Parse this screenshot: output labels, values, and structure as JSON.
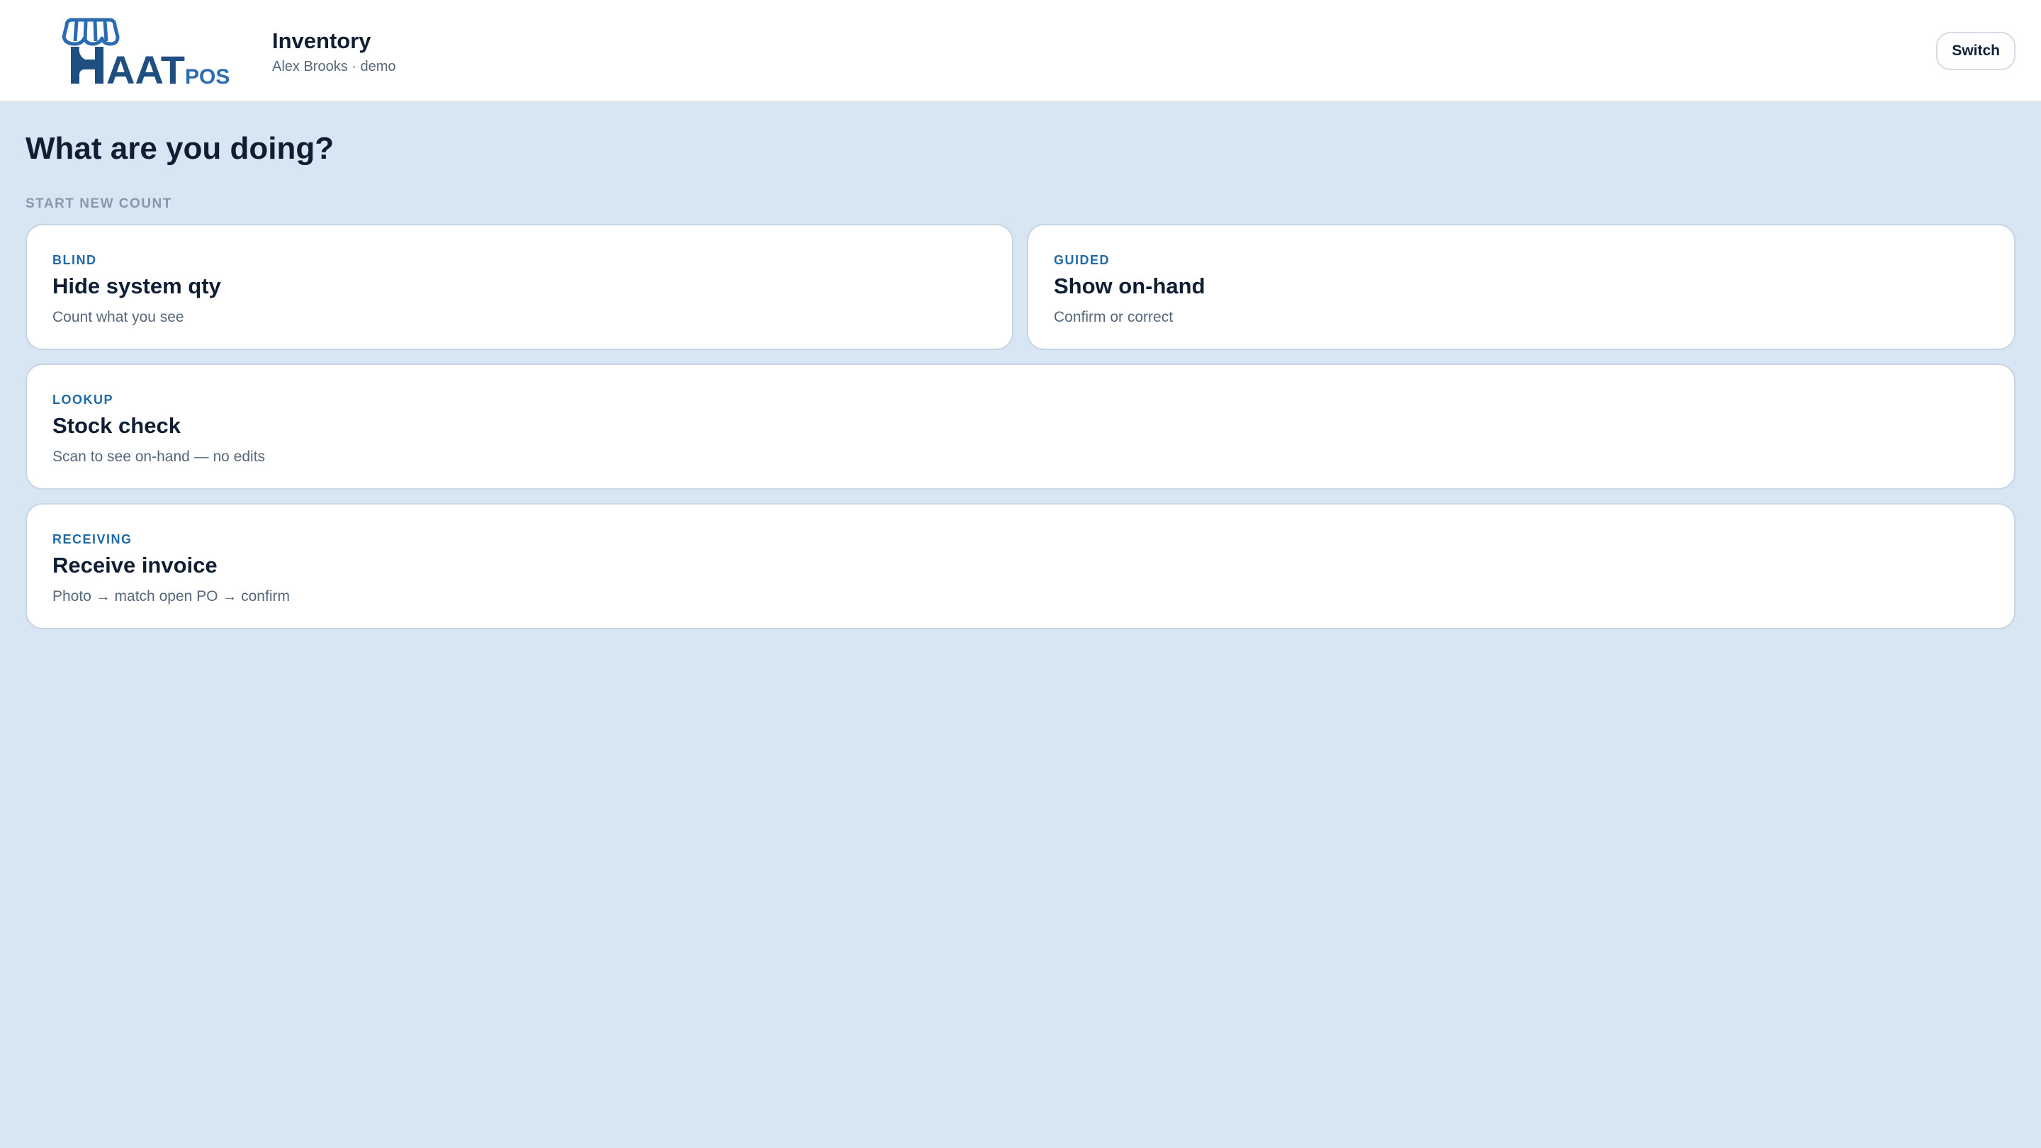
{
  "header": {
    "logo": {
      "wordmark": "HAAT",
      "suffix": "POS",
      "colors": {
        "primary": "#1f4f80",
        "accent": "#2b6cb0"
      }
    },
    "title": "Inventory",
    "subtitle": "Alex Brooks · demo",
    "switch_label": "Switch"
  },
  "main": {
    "heading": "What are you doing?",
    "section_label": "START NEW COUNT",
    "cards": [
      {
        "kicker": "BLIND",
        "title": "Hide system qty",
        "description": "Count what you see"
      },
      {
        "kicker": "GUIDED",
        "title": "Show on-hand",
        "description": "Confirm or correct"
      },
      {
        "kicker": "LOOKUP",
        "title": "Stock check",
        "description": "Scan to see on-hand — no edits"
      },
      {
        "kicker": "RECEIVING",
        "title": "Receive invoice",
        "description": "Photo → match open PO → confirm"
      }
    ]
  },
  "theme": {
    "background": "#d8e5f2",
    "kicker_color": "#1f6aa5",
    "text_color": "#0f1e33"
  }
}
